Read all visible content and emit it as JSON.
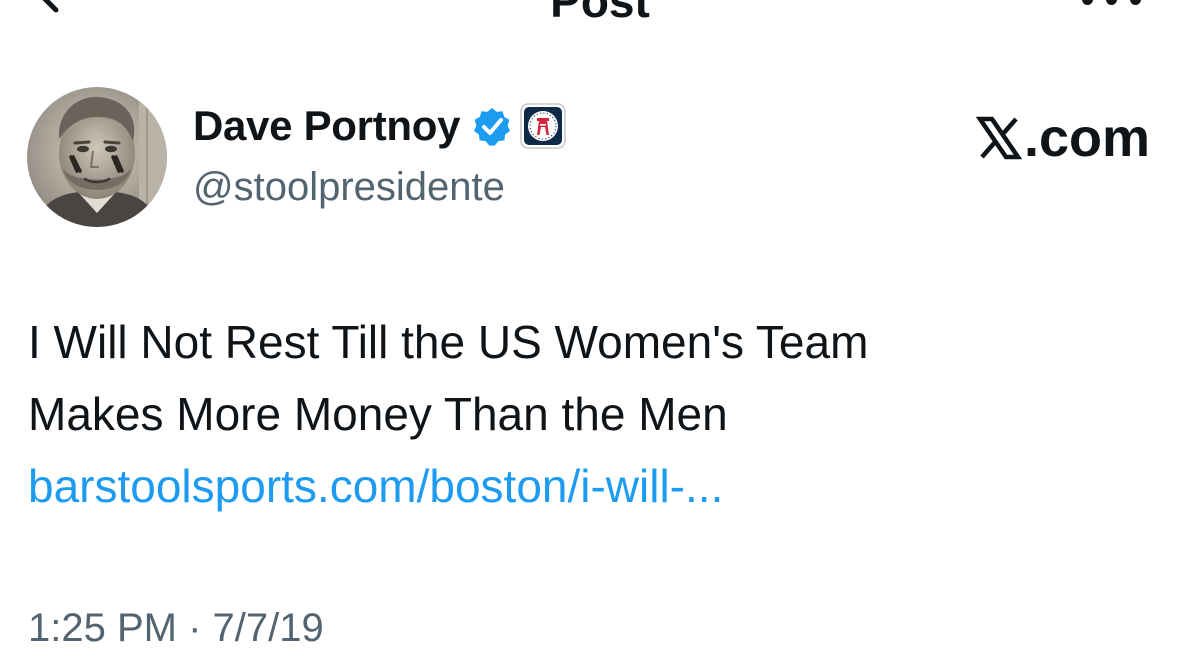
{
  "header": {
    "title": "Post",
    "back_icon": "arrow-left-icon",
    "more_icon": "more-horizontal-icon"
  },
  "author": {
    "display_name": "Dave Portnoy",
    "handle": "@stoolpresidente",
    "verified_icon": "verified-badge-icon",
    "affiliate_icon": "barstool-affiliate-badge-icon",
    "verified_color": "#1d9bf0"
  },
  "watermark": {
    "logo_icon": "x-logo-icon",
    "text": ".com"
  },
  "post": {
    "text_line_1": "I Will Not Rest Till the US Women's Team",
    "text_line_2": "Makes More Money Than the Men",
    "link_text": "barstoolsports.com/boston/i-will-...",
    "link_color": "#1d9bf0"
  },
  "meta": {
    "time": "1:25 PM",
    "separator": "·",
    "date": "7/7/19"
  }
}
